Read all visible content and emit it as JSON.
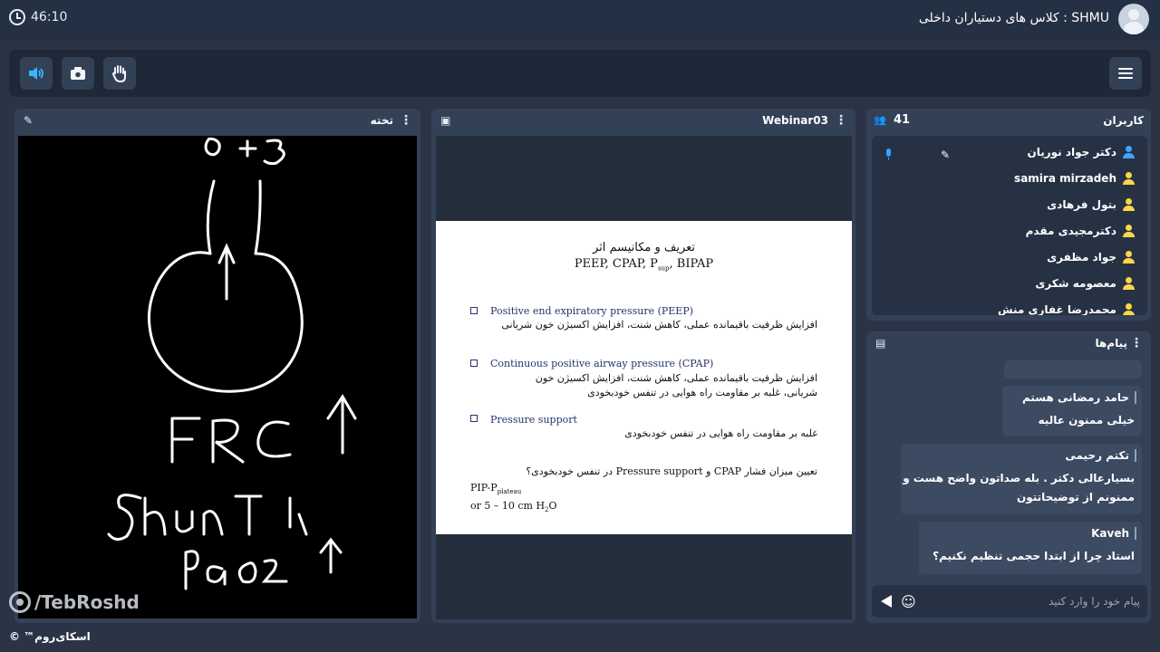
{
  "topbar": {
    "timer": "46:10",
    "room_title": "SHMU : کلاس های دستیاران داخلی"
  },
  "toolbar": {
    "buttons": [
      "speaker-icon",
      "camera-icon",
      "hand-icon"
    ],
    "menu": "hamburger-icon"
  },
  "whiteboard": {
    "title": "تخته",
    "drawn_text": [
      "0+3",
      "FRC",
      "Shunt",
      "PaO2"
    ],
    "watermark": "/TebRoshd"
  },
  "webinar": {
    "title": "Webinar03",
    "slide": {
      "title_fa": "تعریف و مکانیسم اثر",
      "title_en": "PEEP, CPAP, P",
      "title_sub": "sup",
      "title_end": ", BIPAP",
      "items": [
        {
          "en": "Positive end expiratory pressure (PEEP)",
          "fa": "افزایش ظرفیت باقیمانده عملی، کاهش شنت، افزایش اکسیژن خون شریانی"
        },
        {
          "en": "Continuous positive airway pressure (CPAP)",
          "fa1": "افزایش ظرفیت باقیمانده عملی، کاهش شنت، افزایش اکسیژن خون",
          "fa2": "شریانی، غلبه بر مقاومت راه هوایی در تنفس خودبخودی"
        },
        {
          "en": "Pressure support",
          "fa": "غلبه بر مقاومت راه هوایی در تنفس خودبخودی"
        }
      ],
      "question": "تعیین میزان فشار CPAP و Pressure support در تنفس خودبخودی؟",
      "formula_main": "PIP-P",
      "formula_sub": "plateau",
      "range_prefix": "or 5 – 10 cm H",
      "range_sub": "2",
      "range_suffix": "O"
    }
  },
  "users": {
    "title": "کاربران",
    "count": "41",
    "list": [
      {
        "name": "دکتر جواد نوریان",
        "color": "#3ea6ff"
      },
      {
        "name": "samira mirzadeh",
        "color": "#ffd54a"
      },
      {
        "name": "بتول فرهادی",
        "color": "#ffd54a"
      },
      {
        "name": "دکترمجیدی مقدم",
        "color": "#ffd54a"
      },
      {
        "name": "جواد مظفری",
        "color": "#ffd54a"
      },
      {
        "name": "معصومه شکری",
        "color": "#ffd54a"
      },
      {
        "name": "محمدرضا غفاری منش",
        "color": "#ffd54a"
      }
    ]
  },
  "messages": {
    "title": "پیام‌ها",
    "list": [
      {
        "name": "حامد رمضانی هستم",
        "lines": [
          "خیلی ممنون عالیه"
        ]
      },
      {
        "name": "تکتم رحیمی",
        "lines": [
          "بسیارعالی دکتر . بله صداتون واضح هست و",
          "ممنونم از توضیحاتتون"
        ]
      },
      {
        "name": "Kaveh",
        "lines": [
          "استاد چرا از ابتدا حجمی تنظیم نکنیم؟"
        ]
      }
    ],
    "input_placeholder": "پیام خود را وارد کنید"
  },
  "footer": {
    "brand": "اسکای‌روم™ ©"
  }
}
